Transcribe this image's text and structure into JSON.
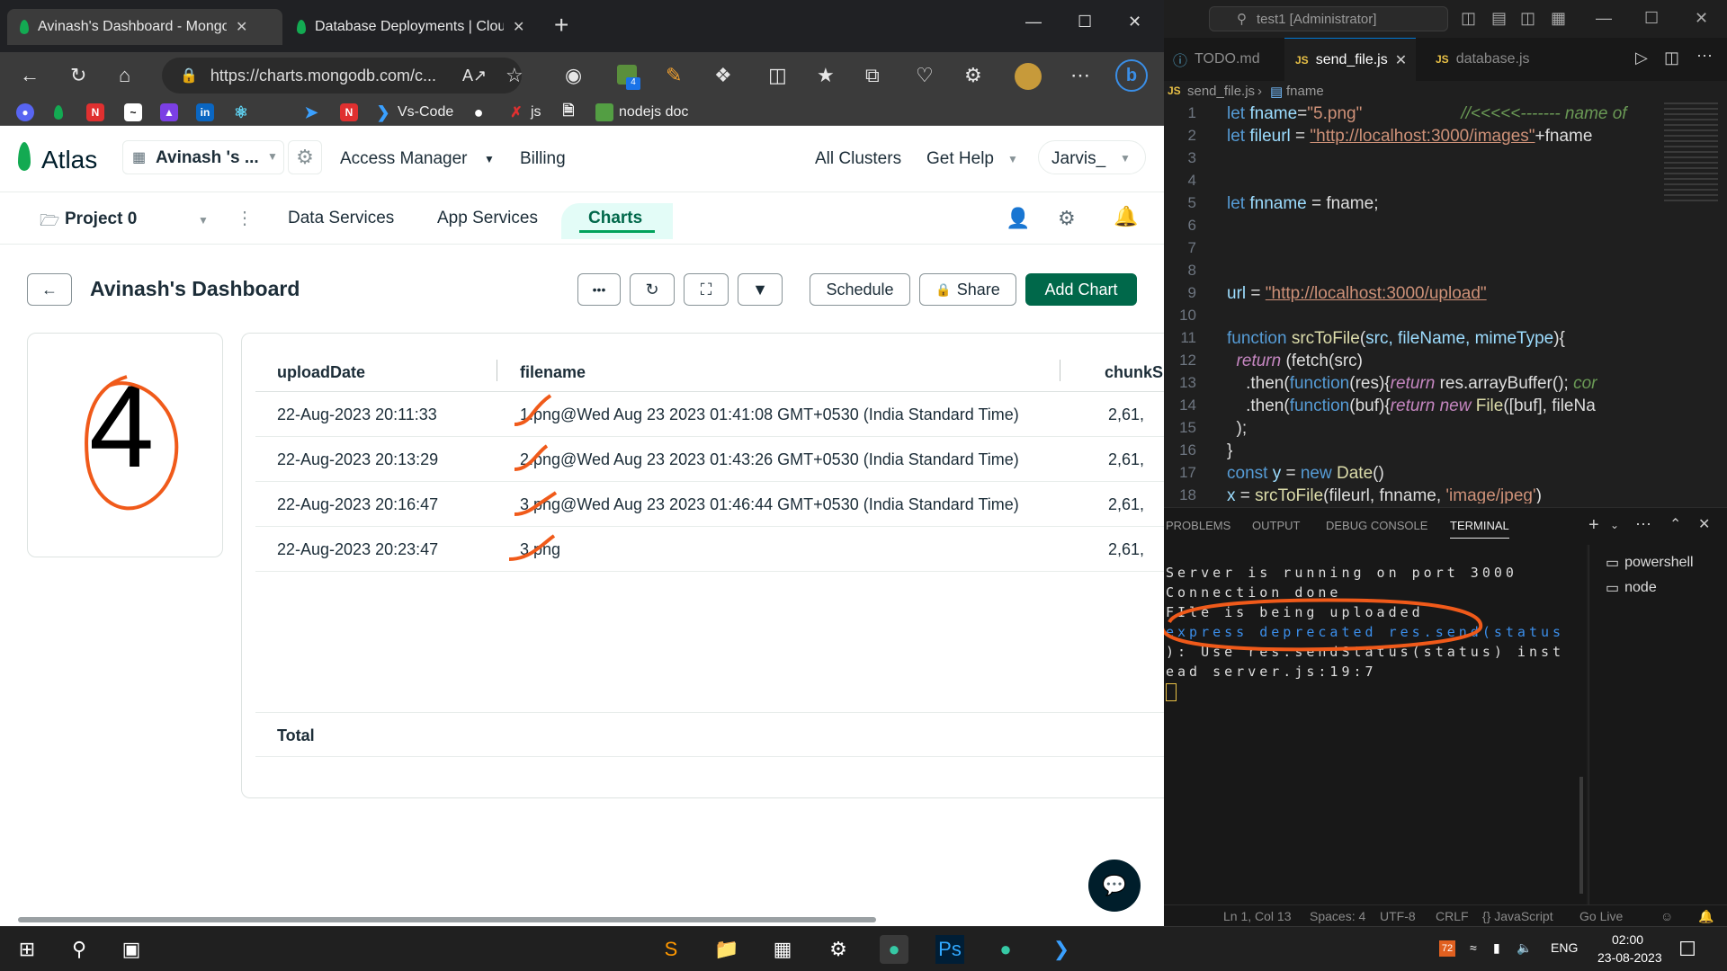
{
  "browser": {
    "tabs": [
      {
        "title": "Avinash's Dashboard - MongoDB",
        "close": "✕"
      },
      {
        "title": "Database Deployments | Cloud: M",
        "close": "✕"
      }
    ],
    "new_tab": "+",
    "address": "https://charts.mongodb.com/c...",
    "bookmarks": [
      "Vs-Code",
      "js",
      "nodejs doc"
    ],
    "extension_badge": "4"
  },
  "atlas": {
    "logo": "Atlas",
    "org": "Avinash 's ...",
    "top_nav": [
      "Access Manager",
      "Billing"
    ],
    "top_right": [
      "All Clusters",
      "Get Help",
      "Jarvis_"
    ],
    "project": "Project 0",
    "nav2": [
      "Data Services",
      "App Services",
      "Charts"
    ],
    "dashboard_title": "Avinash's Dashboard",
    "buttons": {
      "more": "•••",
      "schedule": "Schedule",
      "share": "Share",
      "add_chart": "Add Chart"
    },
    "number_card": "4",
    "table": {
      "headers": [
        "uploadDate",
        "filename",
        "chunkS"
      ],
      "rows": [
        {
          "date": "22-Aug-2023 20:11:33",
          "filename": "1.png@Wed Aug 23 2023 01:41:08 GMT+0530 (India Standard Time)",
          "chunk": "2,61,"
        },
        {
          "date": "22-Aug-2023 20:13:29",
          "filename": "2.png@Wed Aug 23 2023 01:43:26 GMT+0530 (India Standard Time)",
          "chunk": "2,61,"
        },
        {
          "date": "22-Aug-2023 20:16:47",
          "filename": "3.png@Wed Aug 23 2023 01:46:44 GMT+0530 (India Standard Time)",
          "chunk": "2,61,"
        },
        {
          "date": "22-Aug-2023 20:23:47",
          "filename": "3.png",
          "chunk": "2,61,"
        }
      ],
      "total_label": "Total"
    }
  },
  "vscode": {
    "search": "test1 [Administrator]",
    "tabs": [
      "TODO.md",
      "send_file.js",
      "database.js"
    ],
    "breadcrumb": [
      "send_file.js",
      "fname"
    ],
    "code": {
      "line_numbers": [
        "1",
        "2",
        "3",
        "4",
        "5",
        "6",
        "7",
        "8",
        "9",
        "10",
        "11",
        "12",
        "13",
        "14",
        "15",
        "16",
        "17",
        "18"
      ],
      "l1a": "let ",
      "l1b": "fname",
      "l1c": "=",
      "l1d": "\"5.png\"",
      "l1e": "//<<<<<------- name of",
      "l2a": "let ",
      "l2b": "fileurl",
      "l2c": " = ",
      "l2d": "\"http://localhost:3000/images\"",
      "l2e": "+fname",
      "l5a": "let ",
      "l5b": "fnname",
      "l5c": " = fname;",
      "l9a": "url",
      "l9b": " = ",
      "l9c": "\"http://localhost:3000/upload\"",
      "l11a": "function ",
      "l11b": "srcToFile",
      "l11c": "(",
      "l11d": "src, fileName, mimeType",
      "l11e": "){",
      "l12a": "  return ",
      "l12b": "(fetch(src)",
      "l13a": "    .then(",
      "l13b": "function",
      "l13c": "(res){",
      "l13d": "return ",
      "l13e": "res.arrayBuffer(); ",
      "l13f": "cor",
      "l14a": "    .then(",
      "l14b": "function",
      "l14c": "(buf){",
      "l14d": "return new ",
      "l14e": "File",
      "l14f": "([buf], fileNa",
      "l15": "  );",
      "l16": "}",
      "l17a": "const ",
      "l17b": "y",
      "l17c": " = ",
      "l17d": "new ",
      "l17e": "Date",
      "l17f": "()",
      "l18a": "x",
      "l18b": " = ",
      "l18c": "srcToFile",
      "l18d": "(fileurl, fnname, ",
      "l18e": "'image/jpeg'",
      "l18f": ")"
    },
    "panel_tabs": [
      "PROBLEMS",
      "OUTPUT",
      "DEBUG CONSOLE",
      "TERMINAL"
    ],
    "terminal_lines": [
      "Server is running on port 3000",
      "Connection_done",
      "FIle is being uploaded",
      "express deprecated res.send(status",
      "): Use res.sendStatus(status) inst",
      "ead server.js:19:7"
    ],
    "terminals": [
      "powershell",
      "node"
    ],
    "status": [
      "Ln 1, Col 13",
      "Spaces: 4",
      "UTF-8",
      "CRLF",
      "{} JavaScript",
      "Go Live"
    ]
  },
  "taskbar": {
    "lang": "ENG",
    "time": "02:00",
    "date": "23-08-2023",
    "badge": "72"
  },
  "colors": {
    "atlas_green": "#00684a",
    "annotation": "#f05a1a",
    "vscode_bg": "#1f1f1f"
  }
}
